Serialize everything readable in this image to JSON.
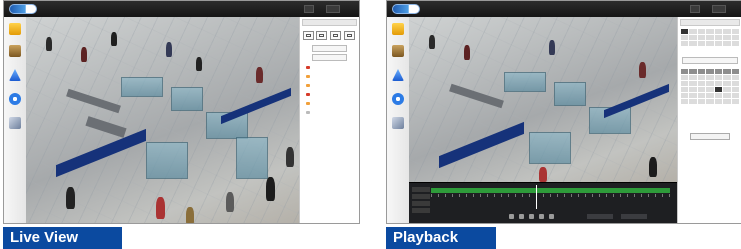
{
  "captions": {
    "live": "Live View",
    "playback": "Playback"
  },
  "colors": {
    "caption_bg": "#0b4aa0",
    "caption_text": "#ffffff",
    "topbar": "#1b1b1b",
    "timeline_bar": "#2e9b3a"
  },
  "icons": {
    "nav": [
      "live-view-icon",
      "playback-icon",
      "alarm-icon",
      "config-icon",
      "tools-icon"
    ]
  }
}
